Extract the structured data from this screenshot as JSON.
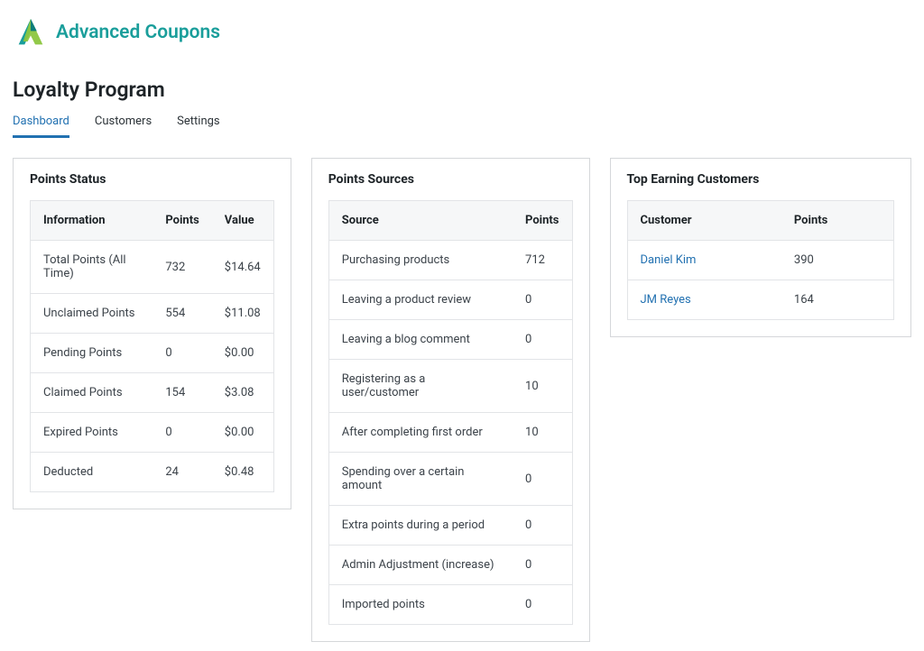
{
  "brand": {
    "name": "Advanced Coupons"
  },
  "page": {
    "title": "Loyalty Program"
  },
  "tabs": [
    {
      "label": "Dashboard",
      "active": true
    },
    {
      "label": "Customers",
      "active": false
    },
    {
      "label": "Settings",
      "active": false
    }
  ],
  "points_status": {
    "title": "Points Status",
    "headers": {
      "info": "Information",
      "points": "Points",
      "value": "Value"
    },
    "rows": [
      {
        "info": "Total Points (All Time)",
        "points": "732",
        "value": "$14.64"
      },
      {
        "info": "Unclaimed Points",
        "points": "554",
        "value": "$11.08"
      },
      {
        "info": "Pending Points",
        "points": "0",
        "value": "$0.00"
      },
      {
        "info": "Claimed Points",
        "points": "154",
        "value": "$3.08"
      },
      {
        "info": "Expired Points",
        "points": "0",
        "value": "$0.00"
      },
      {
        "info": "Deducted",
        "points": "24",
        "value": "$0.48"
      }
    ]
  },
  "points_sources": {
    "title": "Points Sources",
    "headers": {
      "source": "Source",
      "points": "Points"
    },
    "rows": [
      {
        "source": "Purchasing products",
        "points": "712"
      },
      {
        "source": "Leaving a product review",
        "points": "0"
      },
      {
        "source": "Leaving a blog comment",
        "points": "0"
      },
      {
        "source": "Registering as a user/customer",
        "points": "10"
      },
      {
        "source": "After completing first order",
        "points": "10"
      },
      {
        "source": "Spending over a certain amount",
        "points": "0"
      },
      {
        "source": "Extra points during a period",
        "points": "0"
      },
      {
        "source": "Admin Adjustment (increase)",
        "points": "0"
      },
      {
        "source": "Imported points",
        "points": "0"
      }
    ]
  },
  "top_customers": {
    "title": "Top Earning Customers",
    "headers": {
      "customer": "Customer",
      "points": "Points"
    },
    "rows": [
      {
        "customer": "Daniel Kim",
        "points": "390"
      },
      {
        "customer": "JM Reyes",
        "points": "164"
      }
    ]
  }
}
